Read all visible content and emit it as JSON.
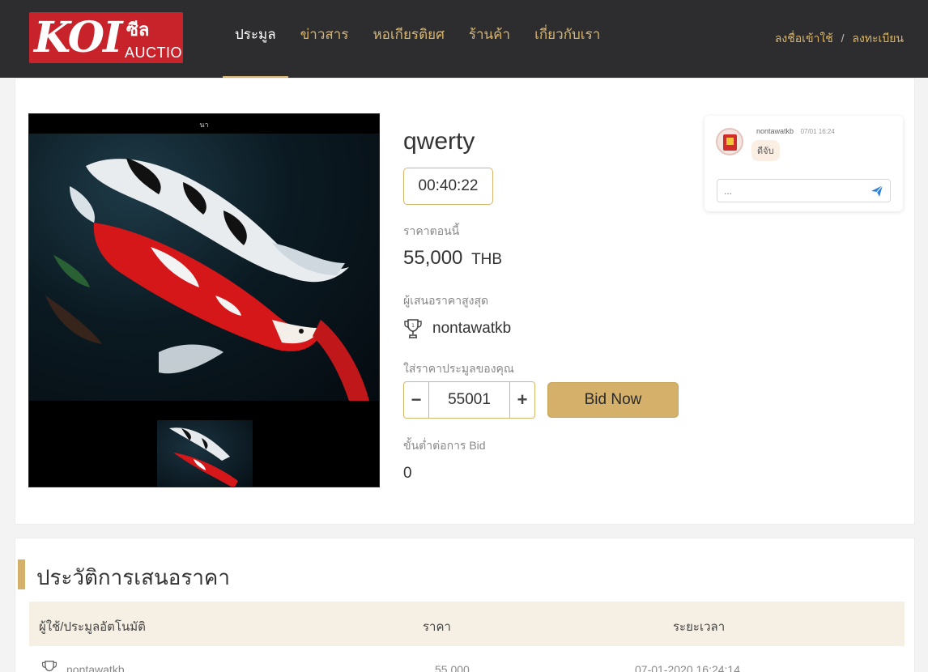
{
  "header": {
    "logo_text": "KOI",
    "logo_mark": "ซีล",
    "logo_sub": "AUCTION",
    "nav": [
      {
        "label": "ประมูล",
        "active": true
      },
      {
        "label": "ข่าวสาร",
        "active": false
      },
      {
        "label": "หอเกียรติยศ",
        "active": false
      },
      {
        "label": "ร้านค้า",
        "active": false
      },
      {
        "label": "เกี่ยวกับเรา",
        "active": false
      }
    ],
    "login": "ลงชื่อเข้าใช้",
    "separator": "/",
    "register": "ลงทะเบียน"
  },
  "item": {
    "photo_caption": "นา",
    "title": "qwerty",
    "timer": "00:40:22",
    "current_price_label": "ราคาตอนนี้",
    "current_price": "55,000",
    "currency": "THB",
    "top_bidder_label": "ผู้เสนอราคาสูงสุด",
    "top_bidder": "nontawatkb",
    "your_bid_label": "ใส่ราคาประมูลของคุณ",
    "bid_value": "55001",
    "minus": "−",
    "plus": "+",
    "bid_button": "Bid Now",
    "min_step_label": "ขั้นต่ำต่อการ Bid",
    "min_step": "0"
  },
  "chat": {
    "user": "nontawatkb",
    "time": "07/01 16:24",
    "message": "ดีจับ",
    "placeholder": "..."
  },
  "history": {
    "title": "ประวัติการเสนอราคา",
    "columns": [
      "ผู้ใช้/ประมูลอัตโนมัติ",
      "ราคา",
      "ระยะเวลา"
    ],
    "rows": [
      {
        "user": "nontawatkb",
        "price": "55,000",
        "time": "07-01-2020 16:24:14"
      }
    ]
  }
}
